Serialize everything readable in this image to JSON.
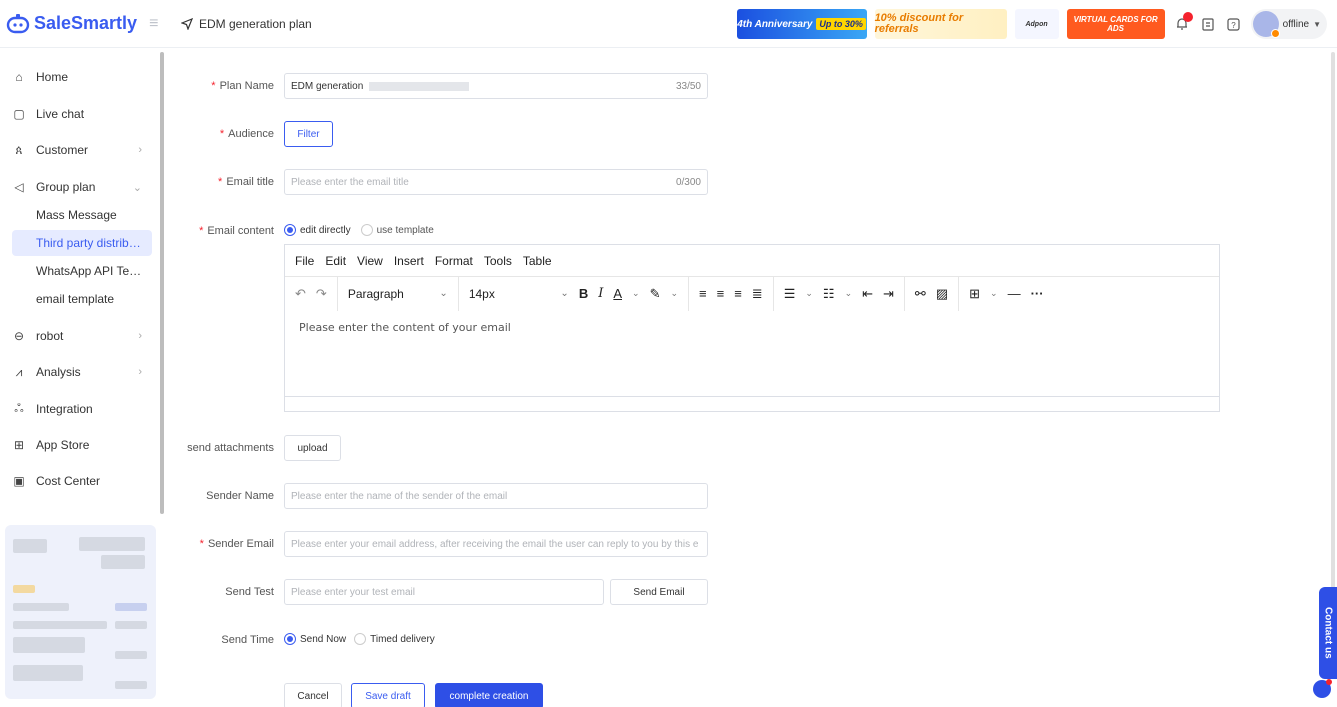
{
  "header": {
    "brand": "SaleSmartly",
    "breadcrumb": "EDM generation plan",
    "banners": {
      "anniversary": "4th Anniversary",
      "anniversary_badge": "Up to 30%",
      "discount": "10% discount for referrals",
      "adpon": "Adpon",
      "vcard": "VIRTUAL CARDS FOR ADS"
    },
    "status": "offline"
  },
  "sidebar": {
    "items": [
      {
        "label": "Home",
        "icon": "home-icon"
      },
      {
        "label": "Live chat",
        "icon": "chat-icon"
      },
      {
        "label": "Customer",
        "icon": "users-icon"
      },
      {
        "label": "Group plan",
        "icon": "send-icon"
      },
      {
        "label": "robot",
        "icon": "robot-icon"
      },
      {
        "label": "Analysis",
        "icon": "analysis-icon"
      },
      {
        "label": "Integration",
        "icon": "integration-icon"
      },
      {
        "label": "App Store",
        "icon": "app-store-icon"
      },
      {
        "label": "Cost Center",
        "icon": "cost-center-icon"
      }
    ],
    "group_plan_sub": [
      "Mass Message",
      "Third party distrib…",
      "WhatsApp API Te…",
      "email template"
    ]
  },
  "form": {
    "plan_name": {
      "label": "Plan Name",
      "value": "EDM generation",
      "count": "33/50"
    },
    "audience": {
      "label": "Audience",
      "button": "Filter"
    },
    "email_title": {
      "label": "Email title",
      "placeholder": "Please enter the email title",
      "count": "0/300"
    },
    "email_content": {
      "label": "Email content",
      "opt_direct": "edit directly",
      "opt_template": "use template",
      "menu": [
        "File",
        "Edit",
        "View",
        "Insert",
        "Format",
        "Tools",
        "Table"
      ],
      "block_format": "Paragraph",
      "font_size": "14px",
      "placeholder": "Please enter the content of your email"
    },
    "attachments": {
      "label": "send attachments",
      "button": "upload"
    },
    "sender_name": {
      "label": "Sender Name",
      "placeholder": "Please enter the name of the sender of the email"
    },
    "sender_email": {
      "label": "Sender Email",
      "placeholder": "Please enter your email address, after receiving the email the user can reply to you by this e"
    },
    "send_test": {
      "label": "Send Test",
      "placeholder": "Please enter your test email",
      "button": "Send Email"
    },
    "send_time": {
      "label": "Send Time",
      "opt_now": "Send Now",
      "opt_timed": "Timed delivery"
    },
    "actions": {
      "cancel": "Cancel",
      "save": "Save draft",
      "complete": "complete creation"
    }
  },
  "contact": "Contact us",
  "colors": {
    "accent": "#2e4fe6",
    "required": "#f5222d"
  }
}
